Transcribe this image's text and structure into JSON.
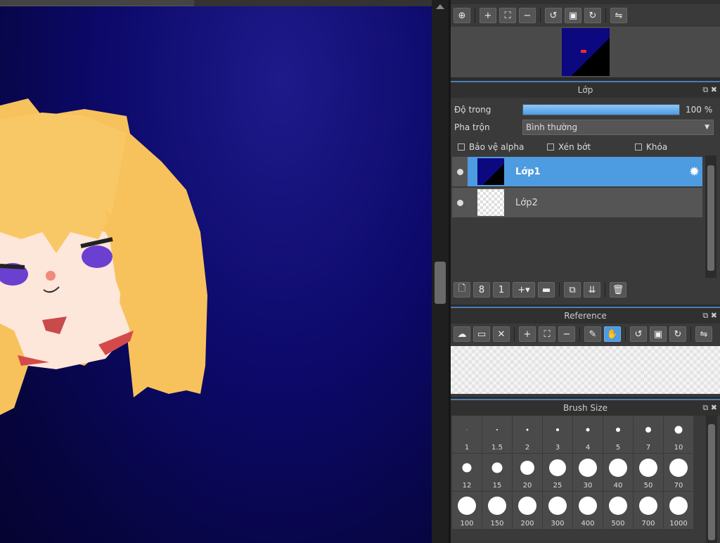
{
  "navigator": {
    "tools": [
      "zoom-fit-icon",
      "zoom-in-icon",
      "fit-icon",
      "zoom-out-icon",
      "rotate-left-icon",
      "reset-icon",
      "rotate-right-icon",
      "flip-icon"
    ]
  },
  "layer_panel": {
    "title": "Lớp",
    "opacity_label": "Độ trong",
    "opacity_value": "100 %",
    "opacity_fraction": 1.0,
    "blend_label": "Pha trộn",
    "blend_value": "Bình thường",
    "protect_alpha": "Bảo vệ alpha",
    "clipping": "Xén bớt",
    "lock": "Khóa",
    "layers": [
      {
        "name": "Lớp1",
        "selected": true
      },
      {
        "name": "Lớp2",
        "selected": false
      }
    ]
  },
  "reference_panel": {
    "title": "Reference"
  },
  "brush_panel": {
    "title": "Brush Size",
    "sizes": [
      "1",
      "1.5",
      "2",
      "3",
      "4",
      "5",
      "7",
      "10",
      "12",
      "15",
      "20",
      "25",
      "30",
      "40",
      "50",
      "70",
      "100",
      "150",
      "200",
      "300",
      "400",
      "500",
      "700",
      "1000"
    ]
  },
  "colors": {
    "accent": "#4d9be0",
    "panel": "#3a3a3a",
    "selected_layer": "#4d9be0"
  }
}
